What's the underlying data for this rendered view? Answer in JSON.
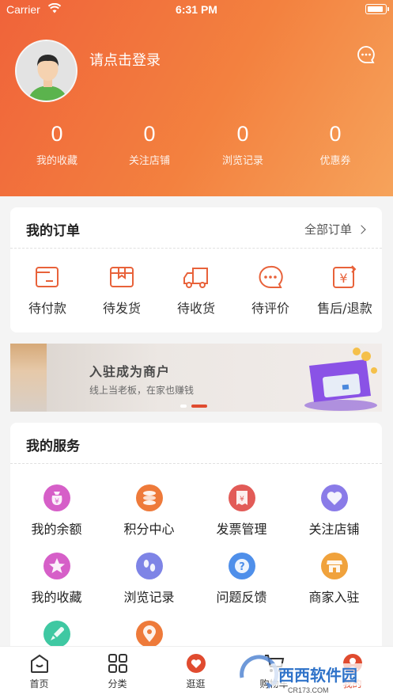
{
  "status_bar": {
    "carrier": "Carrier",
    "time": "6:31 PM"
  },
  "header": {
    "login_prompt": "请点击登录",
    "stats": [
      {
        "value": "0",
        "label": "我的收藏"
      },
      {
        "value": "0",
        "label": "关注店铺"
      },
      {
        "value": "0",
        "label": "浏览记录"
      },
      {
        "value": "0",
        "label": "优惠券"
      }
    ]
  },
  "orders": {
    "title": "我的订单",
    "all_link": "全部订单",
    "items": [
      {
        "label": "待付款",
        "icon": "wallet-icon"
      },
      {
        "label": "待发货",
        "icon": "package-icon"
      },
      {
        "label": "待收货",
        "icon": "truck-icon"
      },
      {
        "label": "待评价",
        "icon": "comment-icon"
      },
      {
        "label": "售后/退款",
        "icon": "refund-icon"
      }
    ]
  },
  "banner": {
    "title": "入驻成为商户",
    "subtitle": "线上当老板，在家也赚钱"
  },
  "services": {
    "title": "我的服务",
    "items": [
      {
        "label": "我的余额",
        "icon": "money-bag-icon",
        "color": "#d65fc8"
      },
      {
        "label": "积分中心",
        "icon": "coins-icon",
        "color": "#ee7a3a"
      },
      {
        "label": "发票管理",
        "icon": "invoice-icon",
        "color": "#e25b57"
      },
      {
        "label": "关注店铺",
        "icon": "heart-icon",
        "color": "#8a7be8"
      },
      {
        "label": "我的收藏",
        "icon": "star-icon",
        "color": "#d65fc8"
      },
      {
        "label": "浏览记录",
        "icon": "footprint-icon",
        "color": "#7e84e6"
      },
      {
        "label": "问题反馈",
        "icon": "question-icon",
        "color": "#4f8fea"
      },
      {
        "label": "商家入驻",
        "icon": "shop-icon",
        "color": "#f0a23c"
      },
      {
        "label": "",
        "icon": "rocket-icon",
        "color": "#3fc8a2"
      },
      {
        "label": "",
        "icon": "location-icon",
        "color": "#ee7a3a"
      }
    ]
  },
  "tabbar": {
    "items": [
      {
        "label": "首页",
        "icon": "home-icon"
      },
      {
        "label": "分类",
        "icon": "grid-icon"
      },
      {
        "label": "逛逛",
        "icon": "heart-tab-icon"
      },
      {
        "label": "购物车",
        "icon": "cart-icon"
      },
      {
        "label": "我的",
        "icon": "profile-icon"
      }
    ]
  },
  "watermark": {
    "text": "西西软件园",
    "url_text": "CR173.COM"
  },
  "colors": {
    "accent": "#e04b2f",
    "header_start": "#f0633a",
    "header_end": "#f6a35b"
  }
}
